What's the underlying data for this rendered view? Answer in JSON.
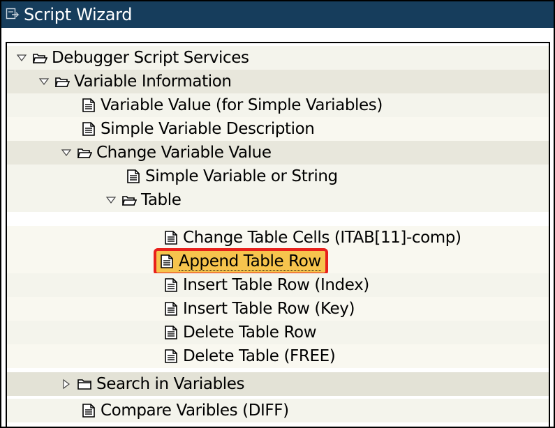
{
  "window": {
    "title": "Script Wizard"
  },
  "tree": {
    "items": [
      {
        "label": "Debugger Script Services"
      },
      {
        "label": "Variable Information"
      },
      {
        "label": "Variable Value (for Simple Variables)"
      },
      {
        "label": "Simple Variable Description"
      },
      {
        "label": "Change Variable Value"
      },
      {
        "label": "Simple Variable or String"
      },
      {
        "label": "Table"
      },
      {
        "label": "Change Table Cells (ITAB[11]-comp)"
      },
      {
        "label": "Append Table Row"
      },
      {
        "label": "Insert Table Row (Index)"
      },
      {
        "label": "Insert Table Row (Key)"
      },
      {
        "label": "Delete Table Row"
      },
      {
        "label": "Delete Table (FREE)"
      },
      {
        "label": "Search in Variables"
      },
      {
        "label": "Compare Varibles (DIFF)"
      }
    ]
  },
  "colors": {
    "titlebar": "#163d5c",
    "selection_fill": "#f6c44d",
    "selection_outline": "#e8201b",
    "stripe_light": "#f4f4ec",
    "stripe_dark": "#e8e7dc"
  }
}
